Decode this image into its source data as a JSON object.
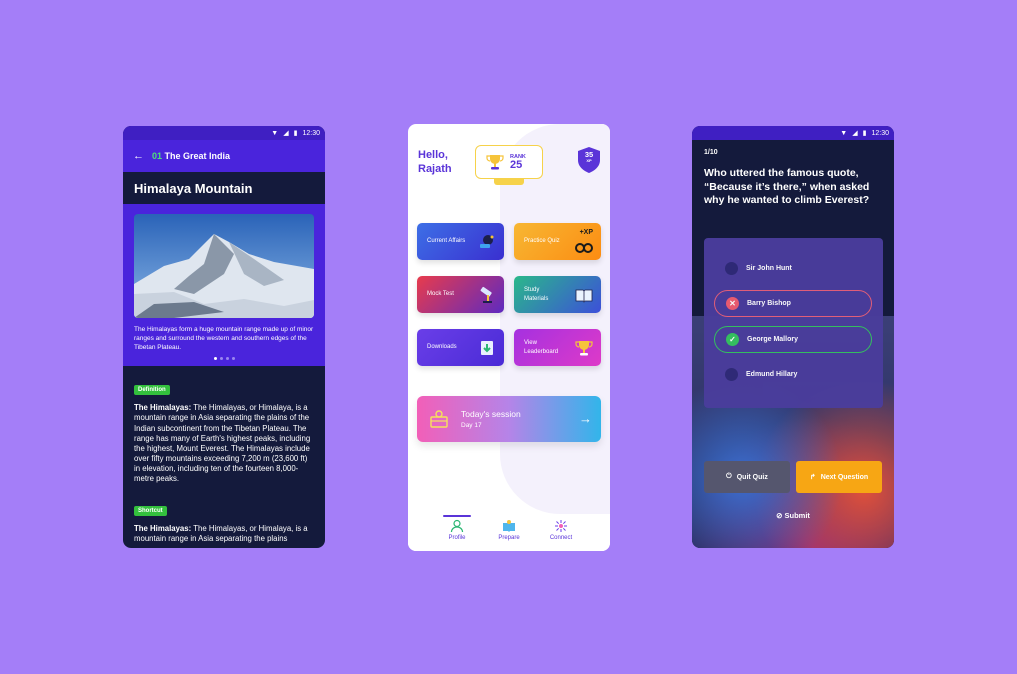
{
  "status": {
    "time": "12:30"
  },
  "screen1": {
    "chapter_number": "01",
    "chapter_title": "The Great India",
    "title": "Himalaya Mountain",
    "caption": "The Himalayas form a huge mountain range made up of minor ranges and surround the western and southern edges of the Tibetan Plateau.",
    "sections": [
      {
        "tag": "Definition",
        "term": "The Himalayas:",
        "text": " The Himalayas, or Himalaya, is a mountain range in Asia separating the plains of the Indian subcontinent from the Tibetan Plateau. The range has many of Earth's highest peaks, including the highest, Mount Everest. The Himalayas include over fifty mountains exceeding 7,200 m (23,600 ft) in elevation, including ten of the fourteen 8,000-metre peaks."
      },
      {
        "tag": "Shortcut",
        "term": "The Himalayas:",
        "text": " The Himalayas, or Himalaya, is a mountain range in Asia separating the plains"
      }
    ]
  },
  "screen2": {
    "greeting_line1": "Hello,",
    "greeting_line2": "Rajath",
    "rank_label": "RANK",
    "rank_value": "25",
    "xp_value": "35",
    "xp_label": "XP",
    "tiles": [
      {
        "label": "Current Affairs",
        "icon": "satellite-dish-icon"
      },
      {
        "label": "Practice Quiz",
        "icon": "binoculars-icon",
        "badge": "+XP"
      },
      {
        "label": "Mock Test",
        "icon": "telescope-icon"
      },
      {
        "label": "Study Materials",
        "icon": "book-icon"
      },
      {
        "label": "Downloads",
        "icon": "download-icon"
      },
      {
        "label": "View Leaderboard",
        "icon": "trophy-icon"
      }
    ],
    "session": {
      "title": "Today's session",
      "subtitle": "Day 17"
    },
    "nav": [
      {
        "label": "Profile",
        "icon": "profile-icon",
        "active": true
      },
      {
        "label": "Prepare",
        "icon": "prepare-icon",
        "active": false
      },
      {
        "label": "Connect",
        "icon": "connect-icon",
        "active": false
      }
    ]
  },
  "screen3": {
    "progress": "1/10",
    "question": "Who uttered the famous quote, “Because it’s there,” when asked why he wanted to climb Everest?",
    "options": [
      {
        "label": "Sir John Hunt",
        "state": "none"
      },
      {
        "label": "Barry Bishop",
        "state": "wrong"
      },
      {
        "label": "George Mallory",
        "state": "correct"
      },
      {
        "label": "Edmund Hillary",
        "state": "none"
      }
    ],
    "quit_label": "Quit Quiz",
    "next_label": "Next Question",
    "submit_label": "Submit"
  },
  "colors": {
    "background": "#a47ef8",
    "primary": "#4a24dc",
    "dark": "#141a3c",
    "correct": "#34c35f",
    "wrong": "#ee5d71",
    "accent": "#f7a614"
  }
}
